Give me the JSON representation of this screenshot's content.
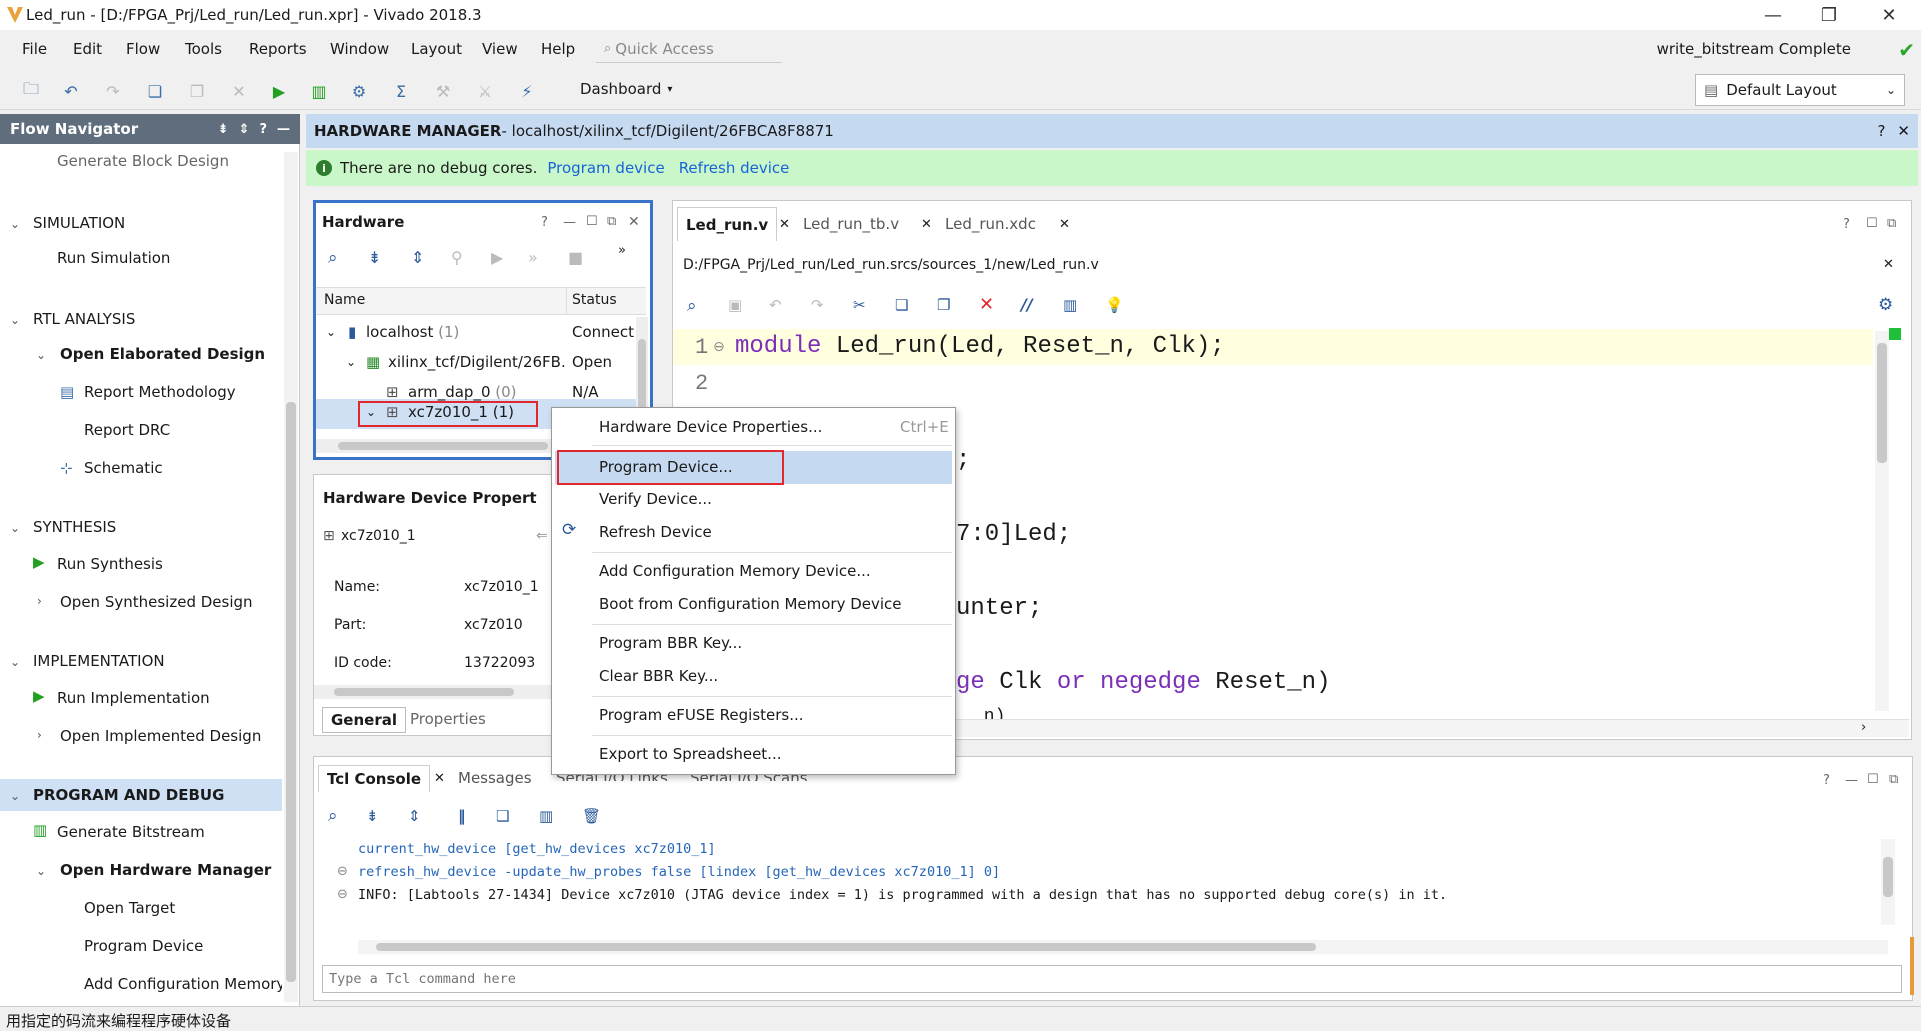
{
  "window": {
    "title": "Led_run - [D:/FPGA_Prj/Led_run/Led_run.xpr] - Vivado 2018.3",
    "minimize": "—",
    "restore": "❐",
    "close": "✕"
  },
  "menu": [
    "File",
    "Edit",
    "Flow",
    "Tools",
    "Reports",
    "Window",
    "Layout",
    "View",
    "Help"
  ],
  "quick_access": "Quick Access",
  "status": {
    "text": "write_bitstream Complete",
    "color": "#2aa52a"
  },
  "toolbar": {
    "dashboard": "Dashboard",
    "layout": "Default Layout"
  },
  "flow_navigator": {
    "title": "Flow Navigator",
    "generate_block_design": "Generate Block Design",
    "simulation": "SIMULATION",
    "run_simulation": "Run Simulation",
    "rtl_analysis": "RTL ANALYSIS",
    "open_elaborated": "Open Elaborated Design",
    "report_methodology": "Report Methodology",
    "report_drc": "Report DRC",
    "schematic": "Schematic",
    "synthesis": "SYNTHESIS",
    "run_synthesis": "Run Synthesis",
    "open_synthesized": "Open Synthesized Design",
    "implementation": "IMPLEMENTATION",
    "run_implementation": "Run Implementation",
    "open_implemented": "Open Implemented Design",
    "program_debug": "PROGRAM AND DEBUG",
    "generate_bitstream": "Generate Bitstream",
    "open_hw_manager": "Open Hardware Manager",
    "open_target": "Open Target",
    "program_device": "Program Device",
    "add_config_mem": "Add Configuration Memory Dev"
  },
  "hw_manager": {
    "title": "HARDWARE MANAGER",
    "path": " - localhost/xilinx_tcf/Digilent/26FBCA8F8871",
    "banner_text": "There are no debug cores.",
    "program_link": "Program device",
    "refresh_link": "Refresh device"
  },
  "hardware_panel": {
    "title": "Hardware",
    "col_name": "Name",
    "col_status": "Status",
    "rows": [
      {
        "name": "localhost",
        "count": " (1)",
        "status": "Connect"
      },
      {
        "name": "xilinx_tcf/Digilent/26FB...",
        "count": "",
        "status": "Open"
      },
      {
        "name": "arm_dap_0",
        "count": " (0)",
        "status": "N/A"
      },
      {
        "name": "xc7z010_1",
        "count": " (1)",
        "status": ""
      }
    ]
  },
  "device_props": {
    "title": "Hardware Device Propert",
    "device": "xc7z010_1",
    "name_label": "Name:",
    "name_value": "xc7z010_1",
    "part_label": "Part:",
    "part_value": "xc7z010",
    "id_label": "ID code:",
    "id_value": "13722093",
    "tab_general": "General",
    "tab_properties": "Properties"
  },
  "editor": {
    "tabs": [
      "Led_run.v",
      "Led_run_tb.v",
      "Led_run.xdc"
    ],
    "file_path": "D:/FPGA_Prj/Led_run/Led_run.srcs/sources_1/new/Led_run.v",
    "line1_num": "1",
    "line2_num": "2",
    "line1_kw": "module",
    "line1_rest": " Led_run(Led, Reset_n, Clk);",
    "frag_semicolon": ";",
    "frag_led": "7:0]Led;",
    "frag_counter": "unter;",
    "frag_ge": "ge",
    "frag_clk": " Clk ",
    "frag_or": "or",
    "frag_negedge": " negedge",
    "frag_reset": " Reset_n)",
    "frag_partial": "_n)"
  },
  "tcl": {
    "tabs": [
      "Tcl Console",
      "Messages",
      "Serial I/O Links",
      "Serial I/O Scans"
    ],
    "lines": [
      "current_hw_device [get_hw_devices xc7z010_1]",
      "refresh_hw_device -update_hw_probes false [lindex [get_hw_devices xc7z010_1] 0]",
      "INFO: [Labtools 27-1434] Device xc7z010 (JTAG device index = 1) is programmed with a design that has no supported debug core(s) in it."
    ],
    "placeholder": "Type a Tcl command here"
  },
  "context_menu": {
    "items": [
      "Hardware Device Properties...",
      "Program Device...",
      "Verify Device...",
      "Refresh Device",
      "Add Configuration Memory Device...",
      "Boot from Configuration Memory Device",
      "Program BBR Key...",
      "Clear BBR Key...",
      "Program eFUSE Registers...",
      "Export to Spreadsheet..."
    ],
    "shortcut": "Ctrl+E"
  },
  "statusbar": "用指定的码流来编程程序硬体设备",
  "colors": {
    "highlight_red": "#e0282e",
    "selection": "#cfe0f5",
    "banner": "#c9f7c9",
    "header": "#c5d9f1"
  }
}
